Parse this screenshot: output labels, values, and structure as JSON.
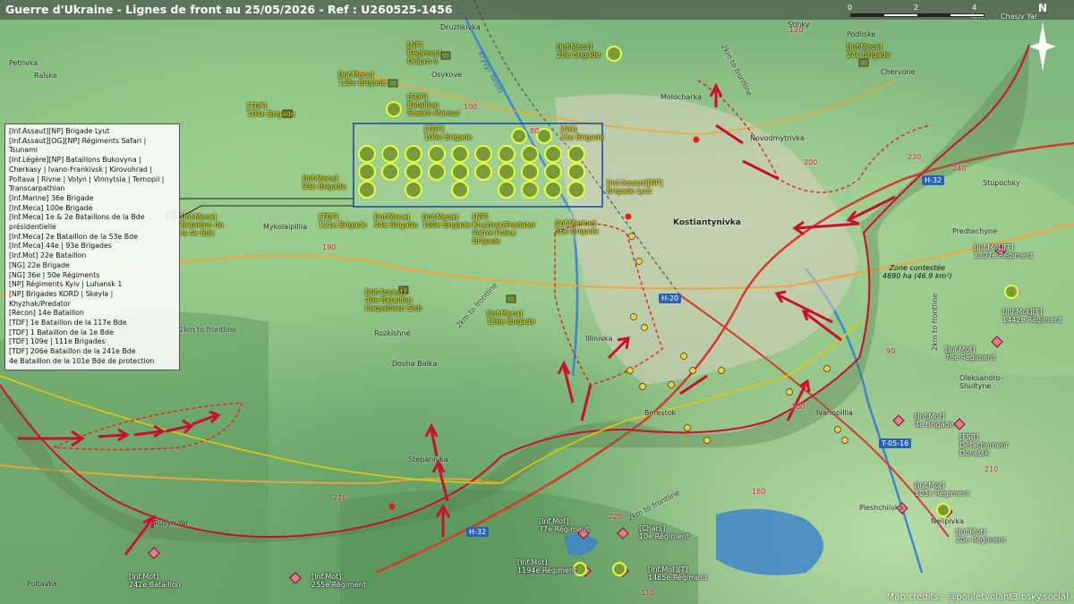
{
  "title": "Guerre d'Ukraine - Lignes de front au 25/05/2026 - Ref : U260525-1456",
  "scale": {
    "zero": "0",
    "two": "2",
    "four": "4 km"
  },
  "north": "N",
  "credits": "Map credits : @pouletvolant3.bsky.social",
  "legend": [
    "[Inf.Assaut][NP] Brigade Lyut",
    "[Inf.Assaut][OG][NP] Régiments Safari | Tsunami",
    "[Inf.Légère][NP] Bataillons Bukovyna | Cherkasy | Ivano-Frankivsk | Kirovohrad | Poltava | Rivne | Volyn | Vinnytsia | Ternopil | Transcarpathian",
    "[Inf.Marine] 36e Brigade",
    "[Inf.Meca] 100e Brigade",
    "[Inf.Meca] 1e & 2e Bataillons de la Bde présidentielle",
    "[Inf.Meca] 2e Bataillon de la 53e Bde",
    "[Inf.Meca] 44e | 93e Brigades",
    "[Inf.Mot] 22e Bataillon",
    "[NG] 22e Brigade",
    "[NG] 36e | 50e Régiments",
    "[NP] Régiments Kyiv | Luhansk 1",
    "[NP] Brigades KORD | Skeyla | Khyzhak/Predator",
    "[Recon] 14e Bataillon",
    "[TDF] 1e Bataillon de la 117e Bde",
    "[TDF] 1 Bataillon de la 1e Bde",
    "[TDF] 109e | 111e Brigades",
    "[TDF] 206e Bataillon de la 241e Bde",
    "4e Bataillon de la 101e Bde de protection"
  ],
  "ua_units": [
    "[Inf.Meca]\n125e Brigade",
    "[TDF]\n104e Brigade",
    "[NP]\nRégiment\nDnipro-1",
    "[SOF]\nBataillon\nSheikh Mansur",
    "[Inf.Meca]\n28e Brigade",
    "[Inf.Meca]\n24e Brigade",
    "[TDF]\n109e Brigade",
    "[NG]\n22e Brigade",
    "[Inf.Meca]\n93e Brigade",
    "[Inf.Assaut][NP]\nBrigade Lyut",
    "[Inf.Meca]\nBataillon de\nla 4e Bde",
    "[TDF]\n111e Brigade",
    "[Inf.Meca]\n44e Brigade",
    "[Inf.Meca]\n100e Brigade",
    "[NP]\nKhyzhak/Predator\nPatrol Police\nBrigade",
    "[Inf.Marine]\n36e Brigade",
    "[Inf.Assaut]\n49e Bataillon\nCarpathian Sich",
    "[Inf.Meca]\n156e Brigade"
  ],
  "ru_units": [
    "[Inf.Mot][T]\n1307e Régiment",
    "[Inf.Mot][T]\n1442e Régiment",
    "[Inf.Mot]\n78e Régiment",
    "[Inf.Mot]\n4e Brigade",
    "[FSB]\nDétachement\nDonetsk",
    "[Inf.Mot]\n103e Régiment",
    "[Inf.Mot]\n20e Régiment",
    "[Inf.Mot]\n77e Régiment",
    "[Chars]\n10e Régiment",
    "[Inf.Mot]\n1194e Régiment",
    "[Inf.Mot][T]\n1465e Régiment",
    "[Inf.Mot]\n242e Bataillon",
    "[Inf.Mot]\n255e Régiment"
  ],
  "places": [
    "Druzhkivka",
    "Petrivka",
    "Rai̇̈ske",
    "Osykove",
    "Molocharka",
    "Novodmytrivka",
    "Podilske",
    "Stinky",
    "Chervone",
    "Predtechyne",
    "Stupochky",
    "Kostiantynivka",
    "Mykolaipillia",
    "Rozkishne",
    "Dovha Balka",
    "Illinivka",
    "Berestok",
    "Ivanopillia",
    "Stepanivka",
    "Rusyn Yar",
    "Poltavka",
    "Pleshchiivka",
    "Nelipivka",
    "Oleksandro-\nShultyne",
    "Chasiv Yar"
  ],
  "zone": {
    "title": "Zone contestée",
    "area": "4690 ha (46.9 km²)"
  },
  "roads": [
    "H-32",
    "H-20",
    "H-32",
    "T-05-16"
  ],
  "road_numbers": [
    "100",
    "80",
    "120",
    "190",
    "200",
    "210",
    "220",
    "240",
    "90",
    "100",
    "180",
    "210",
    "220",
    "110"
  ],
  "frontline_labels": [
    "2km to frontline",
    "2km to frontline",
    "2km to frontline",
    "2km to frontline",
    "2km to frontline"
  ],
  "river": "Kryvyi Torets",
  "colors": {
    "frontline": "#c8102e",
    "ua": "#ffe600",
    "ru": "#e87d8f",
    "box": "#1f4fa6"
  }
}
